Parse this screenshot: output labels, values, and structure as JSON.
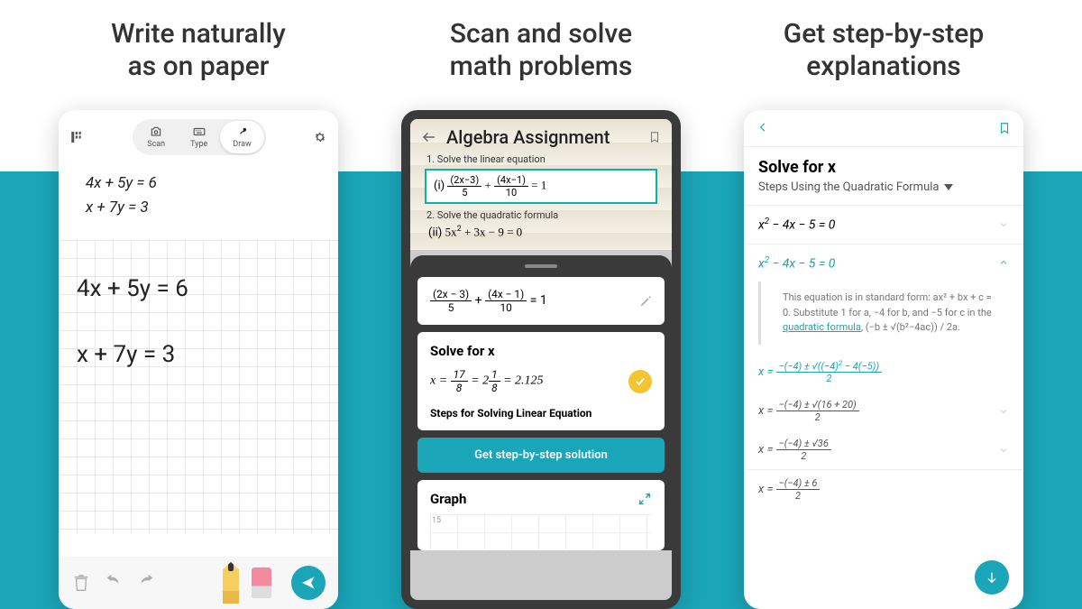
{
  "headlines": {
    "col1_line1": "Write naturally",
    "col1_line2": "as on paper",
    "col2_line1": "Scan and solve",
    "col2_line2": "math problems",
    "col3_line1": "Get step-by-step",
    "col3_line2": "explanations"
  },
  "phone1": {
    "modes": {
      "scan": "Scan",
      "type": "Type",
      "draw": "Draw"
    },
    "typed_eq1": "4x + 5y = 6",
    "typed_eq2": "x + 7y = 3",
    "handwritten_eq1": "4x + 5y = 6",
    "handwritten_eq2": "x + 7y = 3"
  },
  "phone2": {
    "title": "Algebra Assignment",
    "q1": "1. Solve the linear equation",
    "q1_prefix": "(i)",
    "q1_eq": "(2x−3)/5 + (4x−1)/10 = 1",
    "q2": "2. Solve the quadratic formula",
    "q2_prefix": "(ii)",
    "q2_eq": "5x² + 3x − 9 = 0",
    "panel_eq": "(2x − 3)/5 + (4x − 1)/10 = 1",
    "solve_heading": "Solve for x",
    "solution": "x = 17/8 = 2 1/8 = 2.125",
    "steps_label": "Steps for Solving Linear Equation",
    "cta": "Get step-by-step solution",
    "graph_heading": "Graph",
    "graph_ytick": "15"
  },
  "phone3": {
    "title": "Solve for x",
    "subtitle": "Steps Using the Quadratic Formula",
    "step1": "x² − 4x − 5 = 0",
    "step2": "x² − 4x − 5 = 0",
    "explain_pre": "This equation is in standard form: ax² + bx + c = 0. Substitute 1 for a, −4 for b, and −5 for c in the ",
    "explain_link": "quadratic formula",
    "explain_formula": ", (−b ± √(b²−4ac)) / 2a.",
    "f1": "x = (−(−4) ± √((−4)² − 4(−5))) / 2",
    "f2": "x = (−(−4) ± √(16 + 20)) / 2",
    "f3": "x = (−(−4) ± √36) / 2",
    "f4": "x = (−(−4) ± 6) / 2"
  },
  "colors": {
    "accent": "#1aa5b8",
    "check": "#f5c531"
  }
}
